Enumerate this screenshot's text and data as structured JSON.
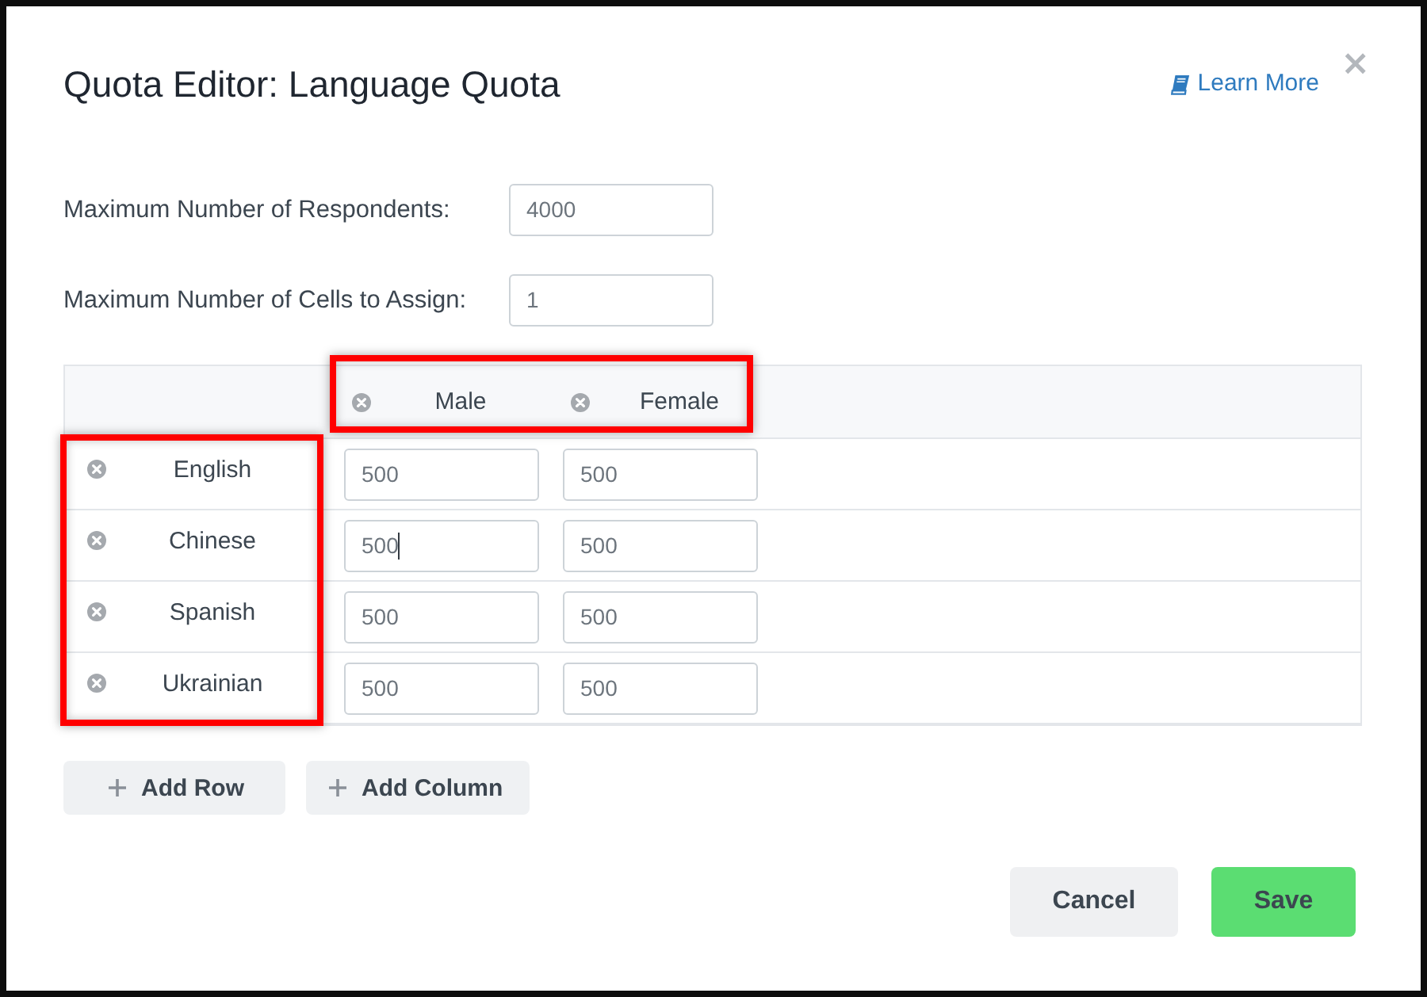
{
  "dialog": {
    "title": "Quota Editor: Language Quota",
    "learn_more": "Learn More",
    "close": "×"
  },
  "fields": [
    {
      "label": "Maximum Number of Respondents:",
      "value": "4000"
    },
    {
      "label": "Maximum Number of Cells to Assign:",
      "value": "1"
    }
  ],
  "table": {
    "columns_highlighted": true,
    "rows_highlighted": true,
    "columns": [
      {
        "label": "Male"
      },
      {
        "label": "Female"
      }
    ],
    "rows": [
      {
        "label": "English",
        "cells": [
          {
            "value": "500",
            "focused": false
          },
          {
            "value": "500",
            "focused": false
          }
        ]
      },
      {
        "label": "Chinese",
        "cells": [
          {
            "value": "500",
            "focused": true
          },
          {
            "value": "500",
            "focused": false
          }
        ]
      },
      {
        "label": "Spanish",
        "cells": [
          {
            "value": "500",
            "focused": false
          },
          {
            "value": "500",
            "focused": false
          }
        ]
      },
      {
        "label": "Ukrainian",
        "cells": [
          {
            "value": "500",
            "focused": false
          },
          {
            "value": "500",
            "focused": false
          }
        ]
      }
    ]
  },
  "table_buttons": [
    "Add Row",
    "Add Column"
  ],
  "footer_buttons": [
    {
      "label": "Cancel",
      "kind": "secondary"
    },
    {
      "label": "Save",
      "kind": "primary"
    }
  ]
}
